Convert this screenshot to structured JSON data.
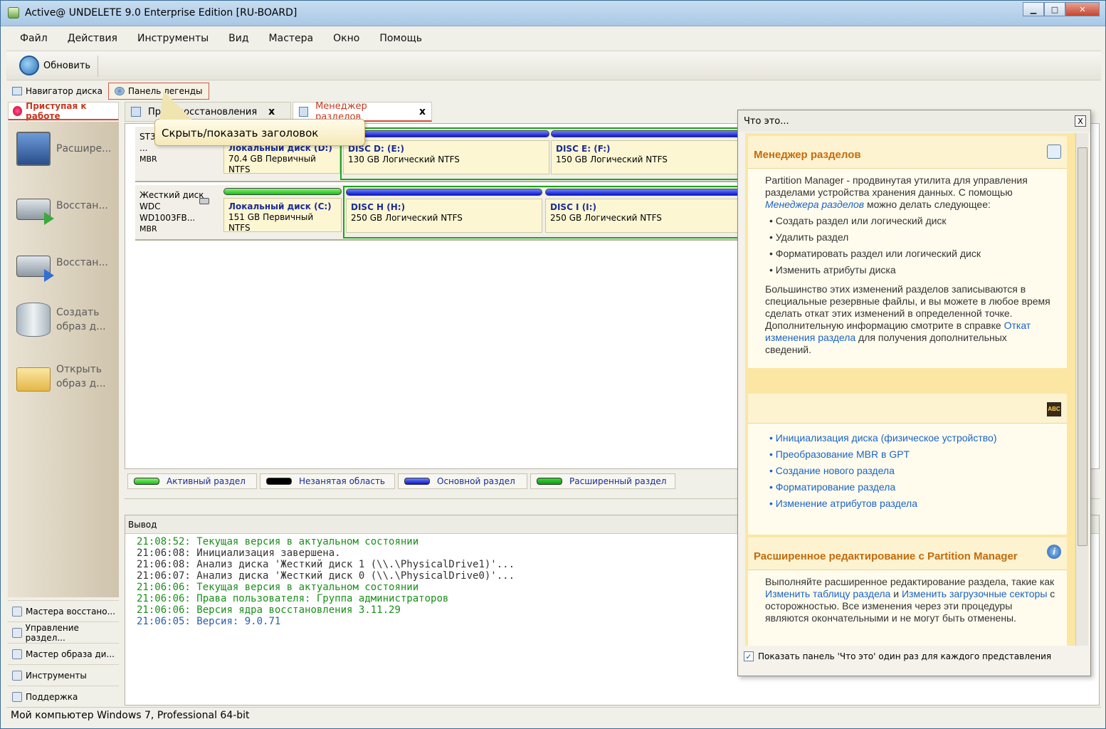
{
  "window": {
    "title": "Active@ UNDELETE 9.0 Enterprise Edition [RU-BOARD]"
  },
  "menu": [
    "Файл",
    "Действия",
    "Инструменты",
    "Вид",
    "Мастера",
    "Окно",
    "Помощь"
  ],
  "toolbar": {
    "refresh_label": "Обновить"
  },
  "subtoolbar": {
    "disk_nav": "Навигатор диска",
    "legend_panel": "Панель легенды"
  },
  "tooltip": "Скрыть/показать заголовок",
  "sidebar": {
    "tab": "Приступая к работе",
    "items": [
      {
        "line1": "Расшире...",
        "line2": ""
      },
      {
        "line1": "Восстан...",
        "line2": ""
      },
      {
        "line1": "Восстан...",
        "line2": ""
      },
      {
        "line1": "Создать",
        "line2": "образ д..."
      },
      {
        "line1": "Открыть",
        "line2": "образ д..."
      }
    ],
    "bottom": [
      "Мастера восстано...",
      "Управление раздел...",
      "Мастер образа ди...",
      "Инструменты",
      "Поддержка"
    ]
  },
  "tabs": [
    {
      "label": "Про...   восстановления",
      "close": "x"
    },
    {
      "label": "Менеджер разделов",
      "close": "x"
    }
  ],
  "disks": [
    {
      "info": [
        "ST3500418AS",
        "...",
        "MBR"
      ],
      "partitions": [
        {
          "name": "Локальный диск (D:)",
          "desc": "70.4 GB Первичный NTFS"
        },
        {
          "name": "DISC D: (E:)",
          "desc": "130 GB Логический NTFS"
        },
        {
          "name": "DISC E: (F:)",
          "desc": "150 GB Логический NTFS"
        }
      ]
    },
    {
      "info": [
        "Жесткий диск",
        "WDC",
        "WD1003FB...",
        "MBR"
      ],
      "partitions": [
        {
          "name": "Локальный диск (C:)",
          "desc": "151 GB Первичный NTFS"
        },
        {
          "name": "DISC H (H:)",
          "desc": "250 GB Логический NTFS"
        },
        {
          "name": "DISC I (I:)",
          "desc": "250 GB Логический NTFS"
        }
      ]
    }
  ],
  "legend": [
    {
      "label": "Активный раздел",
      "color": "#22cc22"
    },
    {
      "label": "Незанятая область",
      "color": "#000000"
    },
    {
      "label": "Основной раздел",
      "color": "#1020d0"
    },
    {
      "label": "Расширенный раздел",
      "color": "#22cc22"
    }
  ],
  "output": {
    "header": "Вывод",
    "lines": [
      {
        "time": "21:08:52:",
        "text": "Текущая версия в актуальном состоянии",
        "color": "green"
      },
      {
        "time": "21:06:08:",
        "text": "Инициализация завершена.",
        "color": "gray"
      },
      {
        "time": "21:06:08:",
        "text": "Анализ диска 'Жесткий диск 1 (\\\\.\\PhysicalDrive1)'...",
        "color": "gray"
      },
      {
        "time": "21:06:07:",
        "text": "Анализ диска 'Жесткий диск 0 (\\\\.\\PhysicalDrive0)'...",
        "color": "gray"
      },
      {
        "time": "21:06:06:",
        "text": "Текущая версия в актуальном состоянии",
        "color": "green"
      },
      {
        "time": "21:06:06:",
        "text": "Права пользователя: Группа администраторов",
        "color": "green"
      },
      {
        "time": "21:06:06:",
        "text": "Версия ядра восстановления 3.11.29",
        "color": "green"
      },
      {
        "time": "21:06:05:",
        "text": "Версия: 9.0.71",
        "color": "blue"
      }
    ]
  },
  "whatis": {
    "title": "Что это...",
    "close": "X",
    "sec1": {
      "heading": "Менеджер разделов",
      "p1a": "Partition Manager - продвинутая утилита для управления разделами устройства хранения данных. С помощью ",
      "p1link": "Менеджера разделов",
      "p1b": " можно делать следующее:",
      "bullets": [
        "Создать раздел или логический диск",
        "Удалить раздел",
        "Форматировать раздел или логический диск",
        "Изменить атрибуты диска"
      ],
      "p2a": "Большинство этих изменений разделов записываются в специальные резервные файлы, и вы можете в любое время сделать откат этих изменений в определенной точке. Дополнительную информацию смотрите в справке ",
      "p2link": "Откат изменения раздела",
      "p2b": " для получения дополнительных сведений."
    },
    "sec2": {
      "icon_text": "ABC",
      "links": [
        "Инициализация диска (физическое устройство)",
        "Преобразование MBR в GPT",
        "Создание нового раздела",
        "Форматирование раздела",
        "Изменение атрибутов раздела"
      ]
    },
    "sec3": {
      "heading": "Расширенное редактирование с Partition Manager",
      "icon_text": "i",
      "a": "Выполняйте расширенное редактирование раздела, такие как ",
      "link1": "Изменить таблицу раздела",
      "b": " и ",
      "link2": "Изменить загрузочные секторы",
      "c": " с осторожностью. Все изменения через эти процедуры являются окончательными и не могут быть отменены."
    },
    "footer_checkbox": "Показать панель 'Что это' один раз для каждого представления",
    "checkbox_checked": true
  },
  "statusbar": "Мой компьютер Windows 7, Professional 64-bit"
}
